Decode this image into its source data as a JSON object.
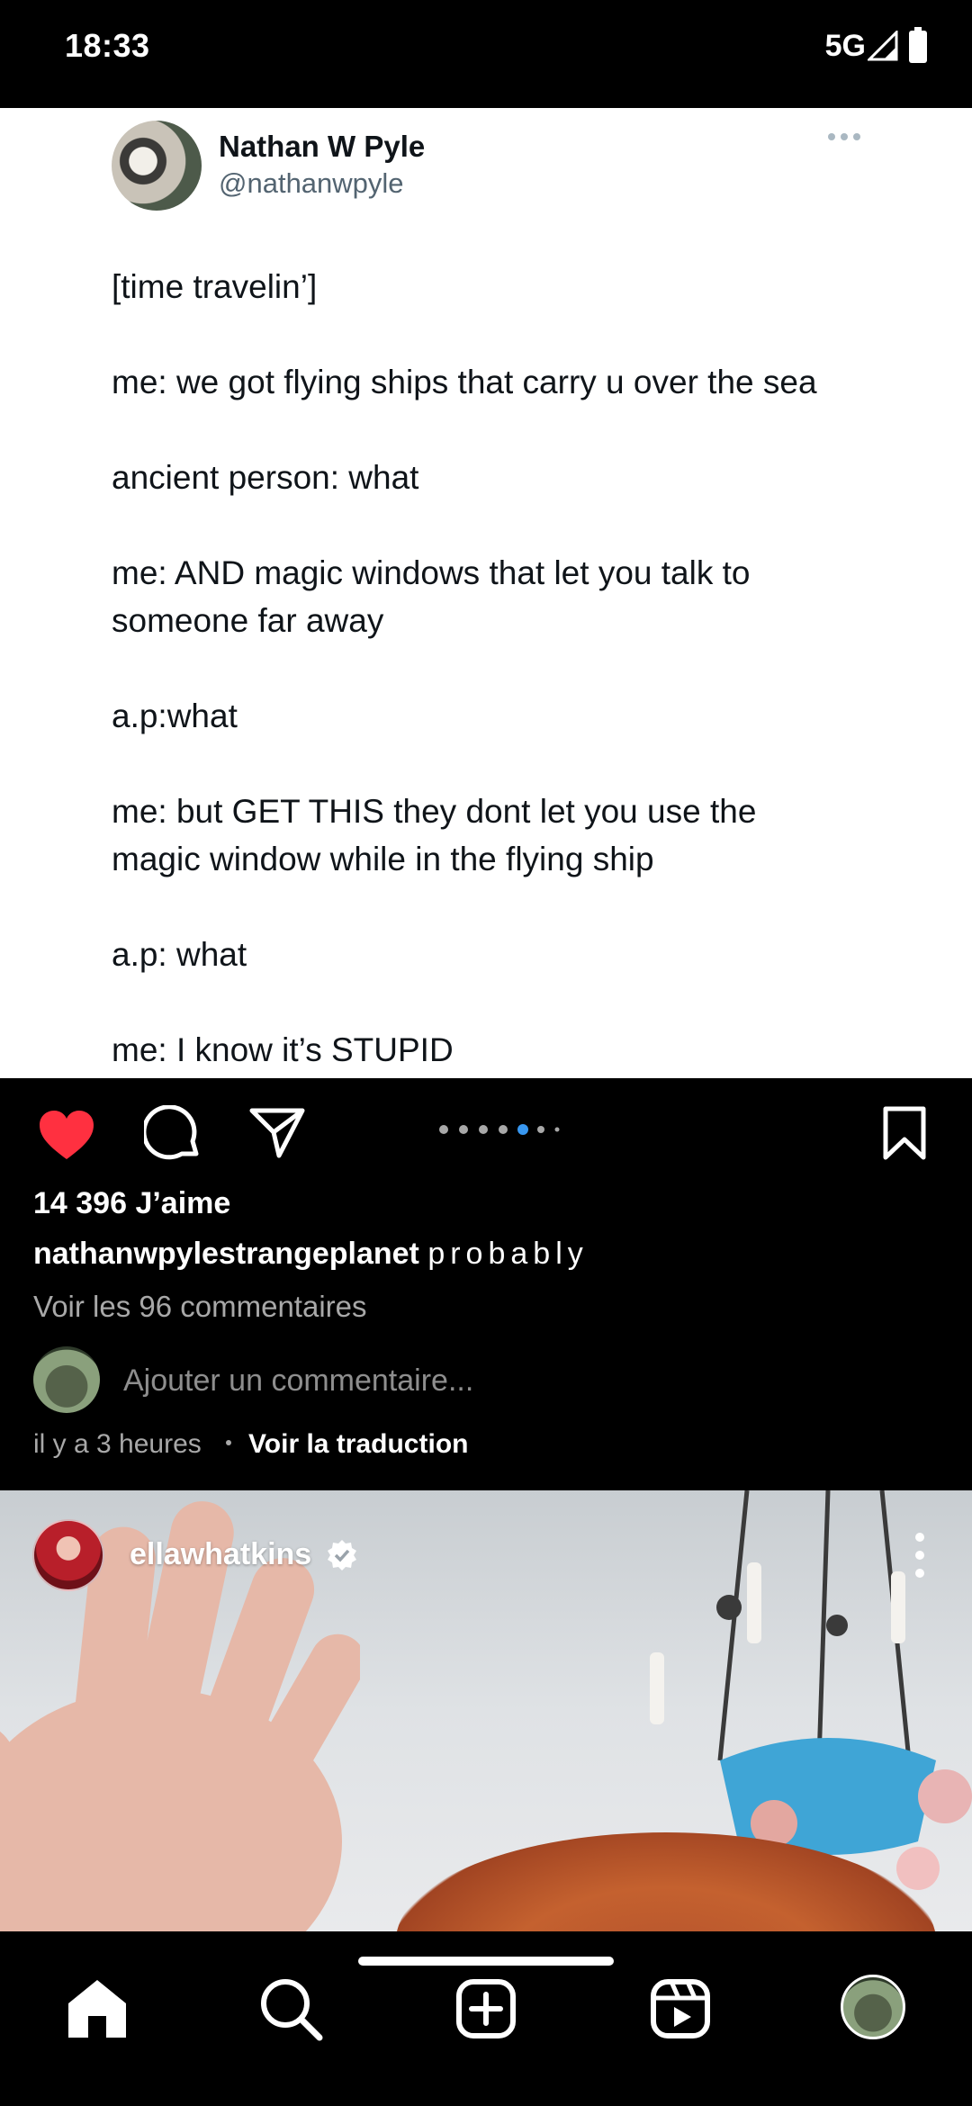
{
  "status": {
    "time": "18:33",
    "network": "5G"
  },
  "tweet": {
    "name": "Nathan W Pyle",
    "handle": "@nathanwpyle",
    "lines": [
      "[time travelin’]",
      "me: we got flying ships that carry u over the sea",
      "ancient person: what",
      "me: AND magic windows that let you talk to",
      "someone far away",
      "a.p:what",
      "me: but GET THIS they dont let you use the",
      "magic window while in the flying ship",
      "a.p: what",
      "me: I know it’s STUPID"
    ]
  },
  "post": {
    "likes": "14 396 J’aime",
    "username": "nathanwpylestrangeplanet",
    "caption": "probably",
    "view_comments": "Voir les 96 commentaires",
    "comment_placeholder": "Ajouter un commentaire...",
    "timestamp": "il y a 3 heures",
    "translate": "Voir la traduction",
    "liked": true,
    "carousel": {
      "count": 7,
      "active": 5
    }
  },
  "next_post": {
    "username": "ellawhatkins",
    "verified": true
  },
  "colors": {
    "like": "#ff3040",
    "active_dot": "#3897f0",
    "background": "#000000"
  },
  "nav": [
    "home-icon",
    "search-icon",
    "create-icon",
    "reels-icon",
    "profile-avatar"
  ]
}
